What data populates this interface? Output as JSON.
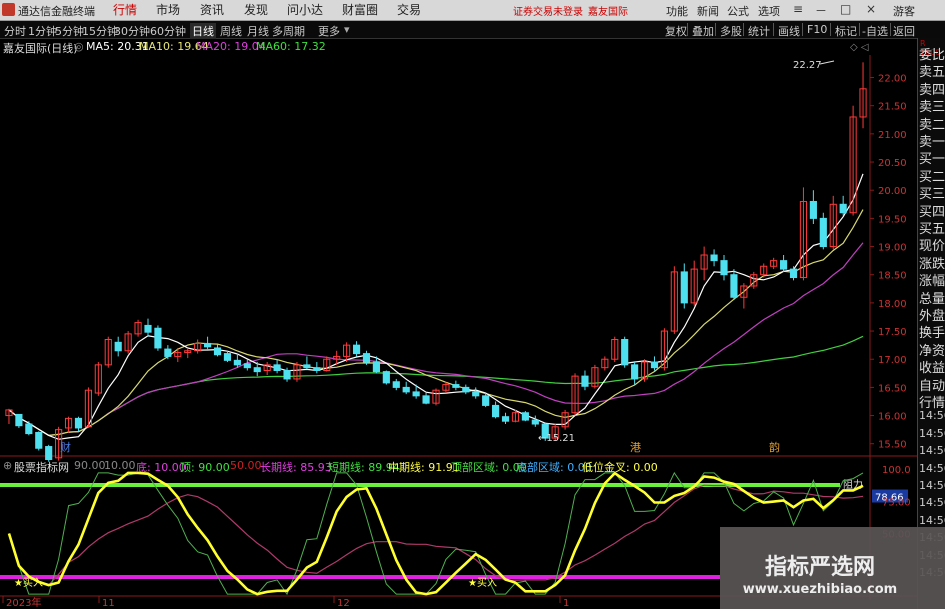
{
  "app": {
    "name": "通达信金融终端"
  },
  "menu": [
    "行情",
    "市场",
    "资讯",
    "发现",
    "问小达",
    "财富圈",
    "交易"
  ],
  "notice": [
    "证券交易未登录",
    "嘉友国际"
  ],
  "top_right": [
    "功能",
    "新闻",
    "公式",
    "选项",
    "游客"
  ],
  "timeframes": [
    "分时",
    "1分钟",
    "5分钟",
    "15分钟",
    "30分钟",
    "60分钟",
    "日线",
    "周线",
    "月线",
    "多周期",
    "更多"
  ],
  "active_timeframe": "日线",
  "toolbar_right": [
    "复权",
    "叠加",
    "多股",
    "统计",
    "画线",
    "F10",
    "标记",
    "-自选",
    "返回"
  ],
  "chart_title": "嘉友国际(日线)",
  "ma": [
    {
      "label": "MA5: 20.31",
      "color": "#ffffff"
    },
    {
      "label": "MA10: 19.64",
      "color": "#e6e67a"
    },
    {
      "label": "MA20: 19.04",
      "color": "#e040e0"
    },
    {
      "label": "MA60: 17.32",
      "color": "#40e040"
    }
  ],
  "price_axis": [
    "22.00",
    "21.50",
    "21.00",
    "20.50",
    "20.00",
    "19.50",
    "19.00",
    "18.50",
    "18.00",
    "17.50",
    "17.00",
    "16.50",
    "16.00",
    "15.50"
  ],
  "annotations": {
    "high": "22.27",
    "low": "15.21",
    "markers": [
      "财",
      "港",
      "韵"
    ]
  },
  "indicator": {
    "name": "股票指标网",
    "params": [
      {
        "text": "90.00",
        "color": "#888888"
      },
      {
        "text": "10.00",
        "color": "#888888"
      },
      {
        "text": "底: 10.00",
        "color": "#e040e0"
      },
      {
        "text": "顶: 90.00",
        "color": "#40e040"
      },
      {
        "text": "50.00",
        "color": "#cc2222"
      },
      {
        "text": "长期线: 85.93",
        "color": "#e040e0"
      },
      {
        "text": "短期线: 89.94",
        "color": "#40e040"
      },
      {
        "text": "中期线: 91.91",
        "color": "#ffff40"
      },
      {
        "text": "顶部区域: 0.00",
        "color": "#40e040"
      },
      {
        "text": "底部区域: 0.00",
        "color": "#40b0ff"
      },
      {
        "text": "低位金叉: 0.00",
        "color": "#ffff40"
      }
    ],
    "axis": [
      "100.0",
      "78.66",
      "75.00",
      "50.00"
    ],
    "resist_label": "阻力",
    "buy_label": "买入"
  },
  "dates": [
    "2023年",
    "11",
    "12",
    "1"
  ],
  "sidebar": {
    "header": "R 1000",
    "items": [
      "委比",
      "卖五",
      "卖四",
      "卖三",
      "卖二",
      "卖一",
      "买一",
      "买二",
      "买三",
      "买四",
      "买五",
      "现价",
      "涨跌",
      "涨幅",
      "总量",
      "外盘",
      "换手",
      "净资",
      "收益",
      "自动",
      "行情",
      "14:56",
      "14:56",
      "14:56",
      "14:56",
      "14:56",
      "14:56",
      "14:56",
      "14:56",
      "14:56",
      "14:56"
    ]
  },
  "watermark": {
    "title": "指标严选网",
    "url": "www.xuezhibiao.com"
  },
  "chart_data": {
    "type": "candlestick",
    "title": "嘉友国际(日线)",
    "ylim": [
      15.3,
      22.4
    ],
    "candles": [
      [
        16.0,
        16.12,
        15.85,
        16.1
      ],
      [
        16.02,
        16.0,
        15.78,
        15.82
      ],
      [
        15.85,
        15.9,
        15.65,
        15.68
      ],
      [
        15.7,
        15.72,
        15.38,
        15.42
      ],
      [
        15.45,
        15.48,
        15.18,
        15.22
      ],
      [
        15.25,
        15.8,
        15.2,
        15.75
      ],
      [
        15.78,
        15.98,
        15.7,
        15.95
      ],
      [
        15.95,
        15.98,
        15.72,
        15.78
      ],
      [
        15.8,
        16.5,
        15.78,
        16.45
      ],
      [
        16.4,
        16.95,
        16.35,
        16.9
      ],
      [
        16.9,
        17.4,
        16.85,
        17.35
      ],
      [
        17.3,
        17.4,
        17.05,
        17.15
      ],
      [
        17.15,
        17.5,
        17.1,
        17.45
      ],
      [
        17.45,
        17.7,
        17.4,
        17.65
      ],
      [
        17.6,
        17.72,
        17.4,
        17.48
      ],
      [
        17.55,
        17.6,
        17.15,
        17.2
      ],
      [
        17.18,
        17.25,
        17.0,
        17.05
      ],
      [
        17.05,
        17.2,
        16.95,
        17.12
      ],
      [
        17.12,
        17.2,
        17.02,
        17.15
      ],
      [
        17.15,
        17.35,
        17.1,
        17.28
      ],
      [
        17.28,
        17.4,
        17.18,
        17.22
      ],
      [
        17.2,
        17.26,
        17.05,
        17.08
      ],
      [
        17.1,
        17.15,
        16.95,
        16.98
      ],
      [
        16.98,
        17.1,
        16.85,
        16.9
      ],
      [
        16.92,
        17.0,
        16.8,
        16.85
      ],
      [
        16.85,
        16.95,
        16.7,
        16.78
      ],
      [
        16.8,
        16.95,
        16.72,
        16.9
      ],
      [
        16.9,
        17.0,
        16.75,
        16.8
      ],
      [
        16.8,
        16.85,
        16.6,
        16.65
      ],
      [
        16.65,
        16.95,
        16.6,
        16.9
      ],
      [
        16.9,
        17.05,
        16.82,
        16.85
      ],
      [
        16.85,
        16.95,
        16.75,
        16.8
      ],
      [
        16.8,
        17.05,
        16.78,
        17.0
      ],
      [
        17.0,
        17.15,
        16.9,
        17.05
      ],
      [
        17.05,
        17.3,
        16.95,
        17.25
      ],
      [
        17.25,
        17.32,
        17.05,
        17.1
      ],
      [
        17.1,
        17.15,
        16.9,
        16.95
      ],
      [
        16.95,
        17.05,
        16.75,
        16.78
      ],
      [
        16.78,
        16.8,
        16.55,
        16.58
      ],
      [
        16.6,
        16.65,
        16.45,
        16.5
      ],
      [
        16.5,
        16.6,
        16.38,
        16.42
      ],
      [
        16.42,
        16.55,
        16.3,
        16.35
      ],
      [
        16.35,
        16.4,
        16.2,
        16.22
      ],
      [
        16.22,
        16.48,
        16.18,
        16.45
      ],
      [
        16.45,
        16.6,
        16.4,
        16.55
      ],
      [
        16.55,
        16.62,
        16.45,
        16.5
      ],
      [
        16.5,
        16.55,
        16.38,
        16.42
      ],
      [
        16.42,
        16.5,
        16.3,
        16.35
      ],
      [
        16.35,
        16.4,
        16.15,
        16.18
      ],
      [
        16.18,
        16.25,
        15.95,
        15.98
      ],
      [
        15.98,
        16.05,
        15.85,
        15.9
      ],
      [
        15.9,
        16.1,
        15.88,
        16.05
      ],
      [
        16.05,
        16.08,
        15.9,
        15.92
      ],
      [
        15.92,
        16.0,
        15.8,
        15.85
      ],
      [
        15.85,
        15.88,
        15.55,
        15.6
      ],
      [
        15.6,
        15.85,
        15.55,
        15.8
      ],
      [
        15.8,
        16.1,
        15.75,
        16.05
      ],
      [
        16.05,
        16.75,
        16.0,
        16.7
      ],
      [
        16.7,
        16.8,
        16.45,
        16.52
      ],
      [
        16.52,
        16.9,
        16.48,
        16.85
      ],
      [
        16.85,
        17.05,
        16.8,
        17.0
      ],
      [
        17.0,
        17.4,
        16.95,
        17.35
      ],
      [
        17.35,
        17.4,
        16.85,
        16.9
      ],
      [
        16.9,
        16.95,
        16.55,
        16.65
      ],
      [
        16.65,
        17.0,
        16.6,
        16.95
      ],
      [
        16.95,
        17.05,
        16.8,
        16.85
      ],
      [
        16.85,
        17.55,
        16.8,
        17.5
      ],
      [
        17.5,
        18.65,
        17.45,
        18.55
      ],
      [
        18.55,
        18.7,
        17.9,
        18.0
      ],
      [
        18.0,
        18.75,
        17.95,
        18.6
      ],
      [
        18.6,
        19.0,
        18.4,
        18.85
      ],
      [
        18.85,
        18.95,
        18.65,
        18.75
      ],
      [
        18.75,
        18.85,
        18.4,
        18.5
      ],
      [
        18.5,
        18.6,
        18.05,
        18.1
      ],
      [
        18.1,
        18.35,
        17.9,
        18.3
      ],
      [
        18.3,
        18.55,
        18.25,
        18.5
      ],
      [
        18.5,
        18.7,
        18.45,
        18.65
      ],
      [
        18.65,
        18.8,
        18.6,
        18.75
      ],
      [
        18.75,
        18.85,
        18.55,
        18.6
      ],
      [
        18.6,
        18.65,
        18.4,
        18.45
      ],
      [
        18.45,
        20.05,
        18.4,
        19.8
      ],
      [
        19.8,
        20.0,
        19.4,
        19.5
      ],
      [
        19.5,
        19.6,
        18.95,
        19.0
      ],
      [
        19.0,
        19.9,
        18.95,
        19.75
      ],
      [
        19.75,
        19.9,
        19.55,
        19.6
      ],
      [
        19.6,
        21.5,
        19.55,
        21.3
      ],
      [
        21.3,
        22.27,
        21.1,
        21.8
      ]
    ]
  }
}
